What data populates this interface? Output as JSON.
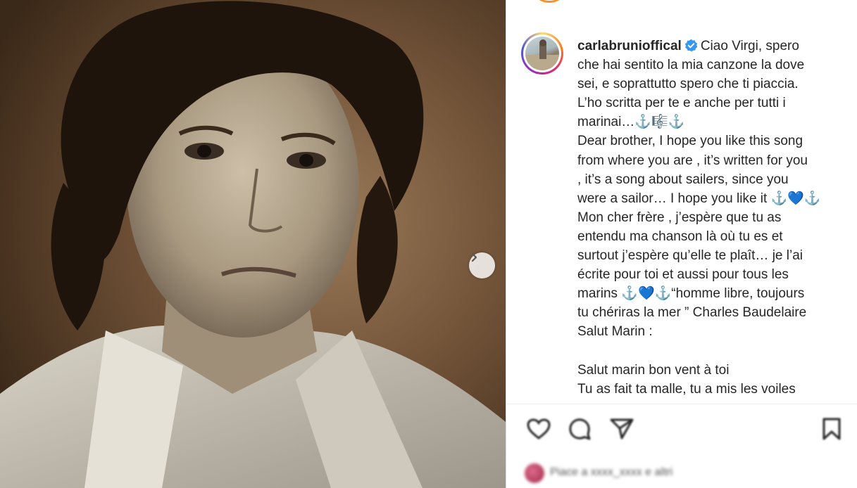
{
  "post": {
    "username": "carlabrunioffical",
    "verified": true,
    "caption_lines": [
      "Ciao Virgi, spero",
      "che hai sentito la mia canzone la dove",
      "sei, e soprattutto spero che ti piaccia.",
      "L’ho scritta per te e anche per tutti i",
      "marinai…⚓🎼⚓",
      "Dear brother, I hope you like this song",
      "from where you are , it’s written for you",
      ", it’s a song about sailers, since you",
      "were a sailor… I hope you like it ⚓💙⚓",
      "Mon cher frère , j’espère que tu as",
      "entendu ma chanson là où tu es et",
      "surtout j’espère qu’elle te plaît… je l’ai",
      "écrite pour toi et aussi pour tous les",
      "marins ⚓💙⚓“homme libre, toujours",
      "tu chériras la mer ” Charles Baudelaire",
      "Salut Marin :",
      "",
      "Salut marin bon vent à toi",
      "Tu as fait ta malle, tu a mis les voiles"
    ],
    "likes_text": "Piace a xxxx_xxxx e altri"
  },
  "icons": {
    "next": "chevron-right-icon",
    "like": "heart-icon",
    "comment": "comment-icon",
    "share": "paper-plane-icon",
    "save": "bookmark-icon",
    "verified": "verified-badge-icon"
  },
  "colors": {
    "verified_blue": "#3897f0",
    "text": "#262626",
    "divider": "#dbdbdb"
  }
}
